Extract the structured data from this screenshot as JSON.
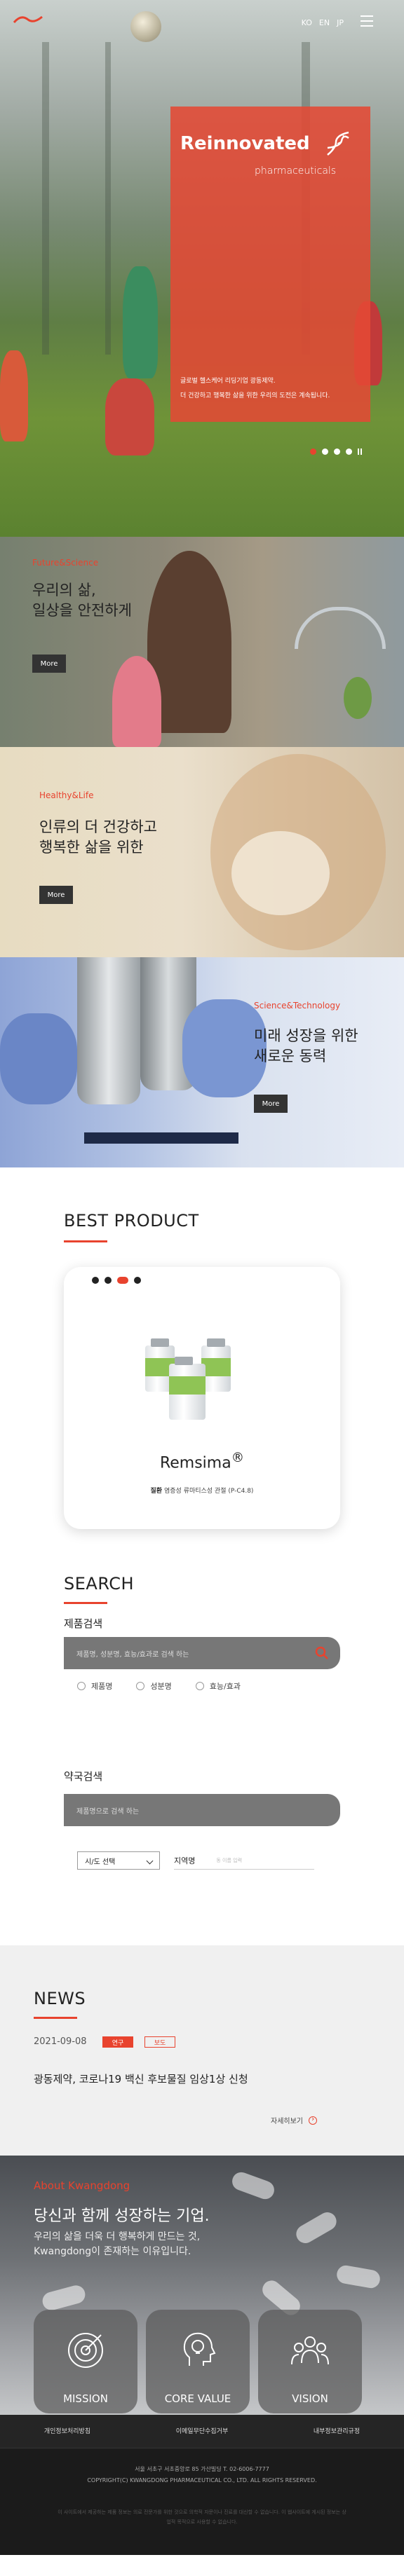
{
  "header": {
    "logo_icon": "kwangdong-logo-icon",
    "languages": [
      "KO",
      "EN",
      "JP"
    ],
    "menu_icon": "hamburger-menu-icon"
  },
  "hero": {
    "title": "Reinnovated",
    "subtitle": "pharmaceuticals",
    "icon": "dna-icon",
    "desc_line1": "글로벌 헬스케어 리딩기업 광동제약.",
    "desc_line2": "더 건강하고 행복한 삶을 위한 우리의 도전은 계속됩니다.",
    "slider_dots": 4,
    "active_dot": 0
  },
  "features": [
    {
      "tag": "Future&Science",
      "heading": "우리의 삶,\n일상을 안전하게",
      "more": "More"
    },
    {
      "tag": "Healthy&Life",
      "heading": "인류의 더 건강하고\n행복한 삶을 위한",
      "more": "More"
    },
    {
      "tag": "Science&Technology",
      "heading": "미래 성장을 위한\n새로운 동력",
      "more": "More"
    }
  ],
  "best_product": {
    "title": "BEST PRODUCT",
    "dots": 4,
    "active_dot": 2,
    "name": "Remsima",
    "mark": "®",
    "desc_label": "질환",
    "desc_value": "염증성 류마티스성 관절 (P-C4.8)"
  },
  "search": {
    "title": "SEARCH",
    "product_search": {
      "label": "제품검색",
      "placeholder": "제품명, 성분명, 효능/효과로 검색 하는",
      "options": [
        "제품명",
        "성분명",
        "효능/효과"
      ]
    },
    "pharmacy_search": {
      "label": "약국검색",
      "placeholder": "제품명으로 검색 하는",
      "select_value": "시/도 선택",
      "region_label": "지역명",
      "region_placeholder": "동 이름 입력"
    }
  },
  "news": {
    "title": "NEWS",
    "date": "2021-09-08",
    "badges": [
      "연구",
      "보도"
    ],
    "headline": "광동제약, 코로나19 백신 후보물질 임상1상 신청",
    "more": "자세히보기"
  },
  "about": {
    "tag": "About Kwangdong",
    "heading": "당신과 함께 성장하는 기업.",
    "text": "우리의 삶을 더욱 더 행복하게 만드는 것,\nKwangdong이 존재하는 이유입니다.",
    "tiles": [
      {
        "label": "MISSION",
        "icon": "target-icon"
      },
      {
        "label": "CORE VALUE",
        "icon": "lightbulb-head-icon"
      },
      {
        "label": "VISION",
        "icon": "people-group-icon"
      }
    ]
  },
  "footer": {
    "links": [
      "개인정보처리방침",
      "이메일무단수집거부",
      "내부정보관리규정"
    ],
    "address": "서울 서초구 서초중앙로 85 가산빌딩 T. 02-6006-7777",
    "copyright": "COPYRIGHT(C) KWANGDONG PHARMACEUTICAL CO., LTD. ALL RIGHTS RESERVED.",
    "note": "이 사이트에서 제공하는 제품 정보는 의료 전문가를 위한 것으로 의학적 자문이나 진료를 대신할 수 없습니다. 이 웹사이트에 게시된 정보는 상업적 목적으로 사용할 수 없습니다.",
    "colors": {
      "accent": "#e8432e",
      "dark": "#1b1b1b"
    }
  }
}
